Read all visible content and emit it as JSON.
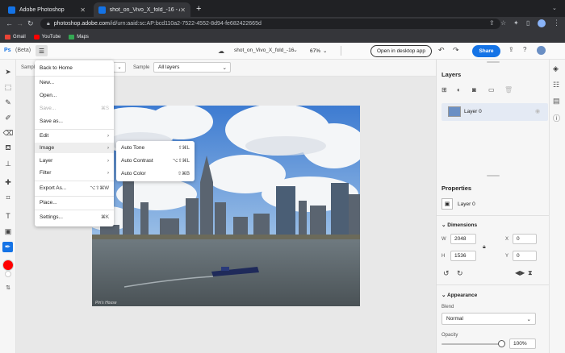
{
  "browser": {
    "tabs": [
      {
        "title": "Adobe Photoshop",
        "active": false
      },
      {
        "title": "shot_on_Vivo_X_fold_-16 - Ad",
        "active": true
      }
    ],
    "new_tab": "+",
    "url_domain": "photoshop.adobe.com",
    "url_path": "/id/urn:aaid:sc:AP:bcd110a2-7522-4552-8d94-fe682422665d",
    "bookmarks": [
      "Gmail",
      "YouTube",
      "Maps"
    ]
  },
  "app": {
    "logo": "Ps",
    "beta": "(Beta)",
    "doc_title": "shot_on_Vivo_X_fold_-16",
    "zoom": "67%",
    "open_desktop": "Open in desktop app",
    "share": "Share"
  },
  "options": {
    "sample_label_left": "Sample",
    "sample_label": "Sample",
    "sample_value": "All layers"
  },
  "main_menu": {
    "items": [
      {
        "label": "Back to Home",
        "shortcut": "",
        "disabled": false,
        "submenu": false
      },
      {
        "label": "New...",
        "shortcut": "",
        "disabled": false,
        "submenu": false
      },
      {
        "label": "Open...",
        "shortcut": "",
        "disabled": false,
        "submenu": false
      },
      {
        "label": "Save...",
        "shortcut": "⌘S",
        "disabled": true,
        "submenu": false
      },
      {
        "label": "Save as...",
        "shortcut": "",
        "disabled": false,
        "submenu": false
      },
      {
        "label": "Edit",
        "shortcut": "",
        "disabled": false,
        "submenu": true
      },
      {
        "label": "Image",
        "shortcut": "",
        "disabled": false,
        "submenu": true
      },
      {
        "label": "Layer",
        "shortcut": "",
        "disabled": false,
        "submenu": true
      },
      {
        "label": "Filter",
        "shortcut": "",
        "disabled": false,
        "submenu": true
      },
      {
        "label": "Export As...",
        "shortcut": "⌥⇧⌘W",
        "disabled": false,
        "submenu": false
      },
      {
        "label": "Place...",
        "shortcut": "",
        "disabled": false,
        "submenu": false
      },
      {
        "label": "Settings...",
        "shortcut": "⌘K",
        "disabled": false,
        "submenu": false
      }
    ]
  },
  "image_submenu": {
    "items": [
      {
        "label": "Auto Tone",
        "shortcut": "⇧⌘L"
      },
      {
        "label": "Auto Contrast",
        "shortcut": "⌥⇧⌘L"
      },
      {
        "label": "Auto Color",
        "shortcut": "⇧⌘B"
      }
    ]
  },
  "photo": {
    "watermark": "Pin's House"
  },
  "layers": {
    "title": "Layers",
    "layer_name": "Layer 0"
  },
  "properties": {
    "title": "Properties",
    "layer_name": "Layer 0",
    "dimensions_title": "Dimensions",
    "w_label": "W",
    "w_value": "2048",
    "h_label": "H",
    "h_value": "1536",
    "x_label": "X",
    "x_value": "0",
    "y_label": "Y",
    "y_value": "0",
    "appearance_title": "Appearance",
    "blend_label": "Blend",
    "blend_value": "Normal",
    "opacity_label": "Opacity",
    "opacity_value": "100%",
    "opacity_level": 1.0
  },
  "colors": {
    "accent": "#1473e6",
    "foreground_color": "#ff0000"
  }
}
